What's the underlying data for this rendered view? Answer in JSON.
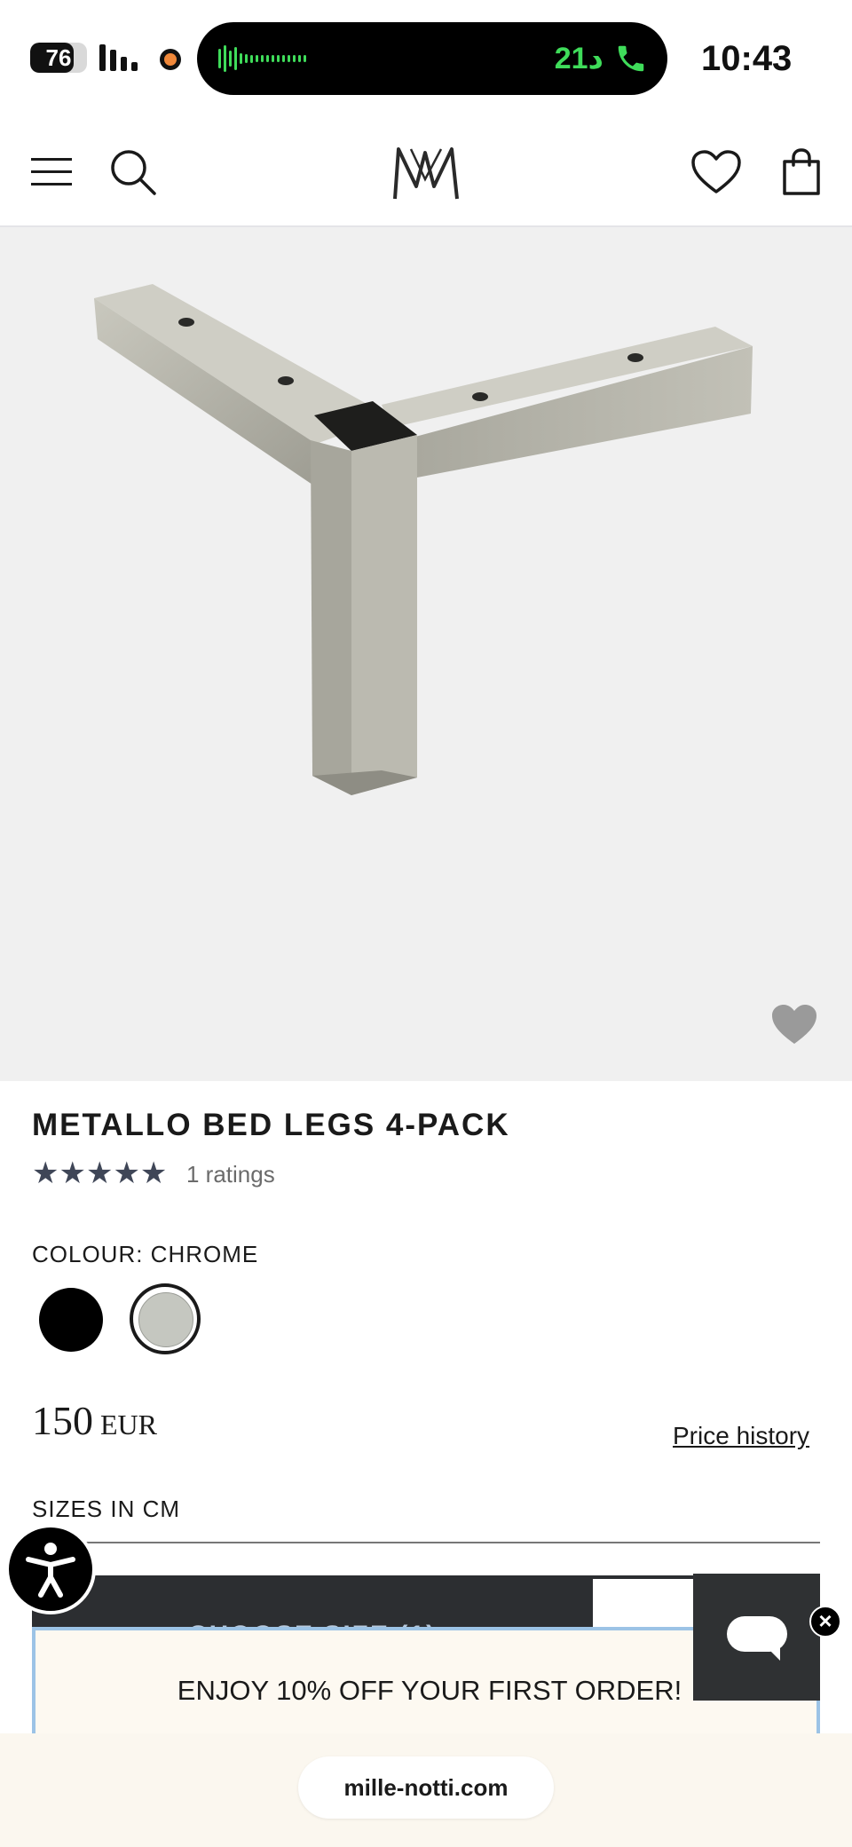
{
  "status_bar": {
    "battery": "76",
    "battery_level": 0.76,
    "call_duration": "21د",
    "time": "10:43"
  },
  "header": {
    "logo_text": "MN"
  },
  "product": {
    "title": "METALLO BED LEGS 4-PACK",
    "stars": "★★★★★",
    "rating_value": 5,
    "ratings_text": "1 ratings",
    "colour_label": "COLOUR: CHROME",
    "swatches": [
      {
        "name": "black",
        "color": "#000000"
      },
      {
        "name": "chrome",
        "color": "#c5c7c0",
        "selected": true
      }
    ],
    "price_amount": "150",
    "price_currency": "EUR",
    "price_history_label": "Price history",
    "sizes_label": "SIZES IN CM",
    "choose_size_label": "CHOOSE SIZE (1)"
  },
  "promo": {
    "text": "ENJOY 10% OFF YOUR FIRST ORDER!"
  },
  "browser": {
    "url": "mille-notti.com"
  },
  "colors": {
    "accent_dark": "#2c2e31",
    "promo_border": "#9cc3e6",
    "call_green": "#3fdc5a"
  }
}
